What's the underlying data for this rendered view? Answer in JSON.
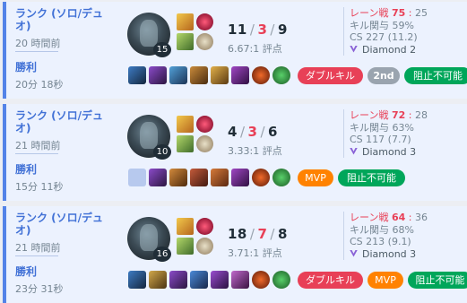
{
  "matches": [
    {
      "queue": "ランク (ソロ/デュオ)",
      "time_ago": "20 時間前",
      "result": "勝利",
      "duration": "20分 18秒",
      "level": "15",
      "kills": "11",
      "deaths": "3",
      "assists": "9",
      "kda_ratio": "6.67:1 評点",
      "kill_participation_label": "キル関与 59%",
      "laning_label": "レーン戦",
      "laning_a": "75",
      "laning_b": "25",
      "cs": "CS 227 (11.2)",
      "tier": "Diamond 2",
      "badges": [
        "ダブルキル",
        "2nd",
        "阻止不可能"
      ]
    },
    {
      "queue": "ランク (ソロ/デュオ)",
      "time_ago": "21 時間前",
      "result": "勝利",
      "duration": "15分 11秒",
      "level": "10",
      "kills": "4",
      "deaths": "3",
      "assists": "6",
      "kda_ratio": "3.33:1 評点",
      "kill_participation_label": "キル関与 63%",
      "laning_label": "レーン戦",
      "laning_a": "72",
      "laning_b": "28",
      "cs": "CS 117 (7.7)",
      "tier": "Diamond 3",
      "badges": [
        "MVP",
        "阻止不可能"
      ]
    },
    {
      "queue": "ランク (ソロ/デュオ)",
      "time_ago": "21 時間前",
      "result": "勝利",
      "duration": "23分 31秒",
      "level": "16",
      "kills": "18",
      "deaths": "7",
      "assists": "8",
      "kda_ratio": "3.71:1 評点",
      "kill_participation_label": "キル関与 68%",
      "laning_label": "レーン戦",
      "laning_a": "64",
      "laning_b": "36",
      "cs": "CS 213 (9.1)",
      "tier": "Diamond 3",
      "badges": [
        "ダブルキル",
        "MVP",
        "阻止不可能"
      ]
    }
  ],
  "colors": {
    "accent": "#5383e8",
    "win_bg": "#ecf2fe",
    "death": "#e84057",
    "badge_red": "#e84057",
    "badge_orange": "#ff8200",
    "badge_green": "#00a65a",
    "badge_gray": "#9aa4af"
  }
}
